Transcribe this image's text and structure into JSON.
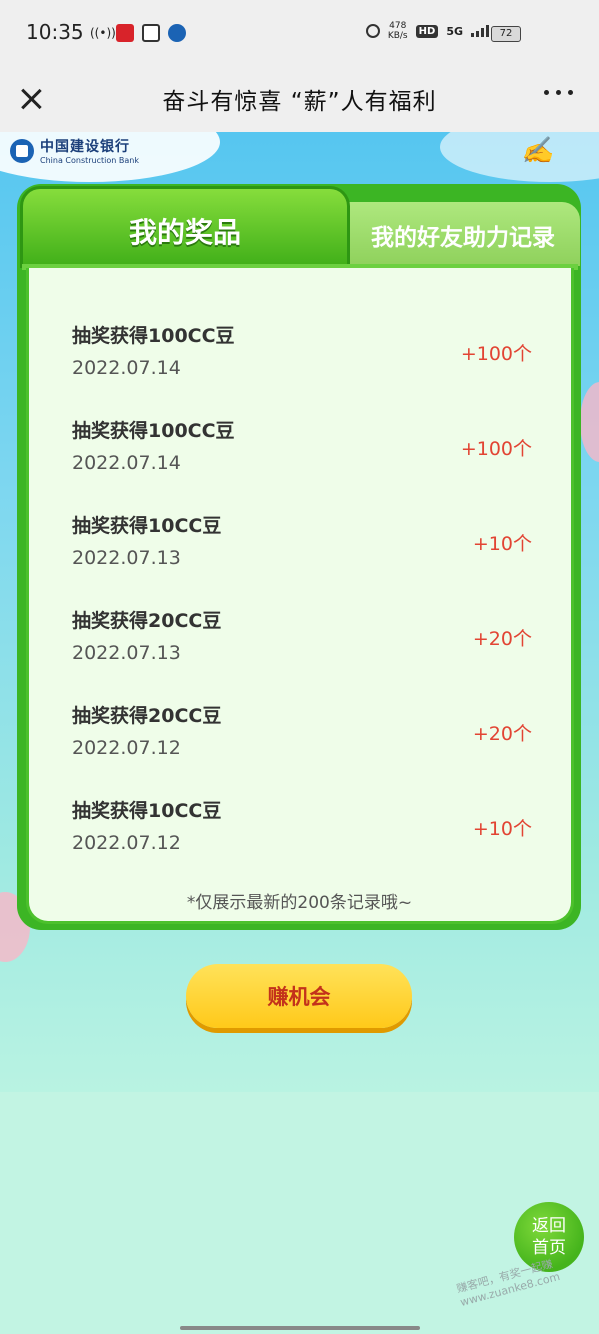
{
  "status_bar": {
    "time": "10:35",
    "net_speed_value": "478",
    "net_speed_unit": "KB/s",
    "hd": "HD",
    "network": "5G",
    "battery": "72"
  },
  "title_bar": {
    "title": "奋斗有惊喜 “薪”人有福利"
  },
  "brand": {
    "bank_name_cn": "中国建设银行",
    "bank_name_en": "China Construction Bank"
  },
  "tabs": [
    {
      "label": "我的奖品",
      "active": true
    },
    {
      "label": "我的好友助力记录",
      "active": false
    }
  ],
  "records": [
    {
      "name": "抽奖获得100CC豆",
      "date": "2022.07.14",
      "amount": "+100个"
    },
    {
      "name": "抽奖获得100CC豆",
      "date": "2022.07.14",
      "amount": "+100个"
    },
    {
      "name": "抽奖获得10CC豆",
      "date": "2022.07.13",
      "amount": "+10个"
    },
    {
      "name": "抽奖获得20CC豆",
      "date": "2022.07.13",
      "amount": "+20个"
    },
    {
      "name": "抽奖获得20CC豆",
      "date": "2022.07.12",
      "amount": "+20个"
    },
    {
      "name": "抽奖获得10CC豆",
      "date": "2022.07.12",
      "amount": "+10个"
    }
  ],
  "footnote": "*仅展示最新的200条记录哦~",
  "earn_button": "赚机会",
  "home_button": {
    "line1": "返回",
    "line2": "首页"
  },
  "watermark": "赚客吧，有奖一起赚 www.zuanke8.com",
  "colors": {
    "accent_green": "#3cb524",
    "amount_red": "#e24433",
    "button_yellow": "#ffc91a"
  }
}
